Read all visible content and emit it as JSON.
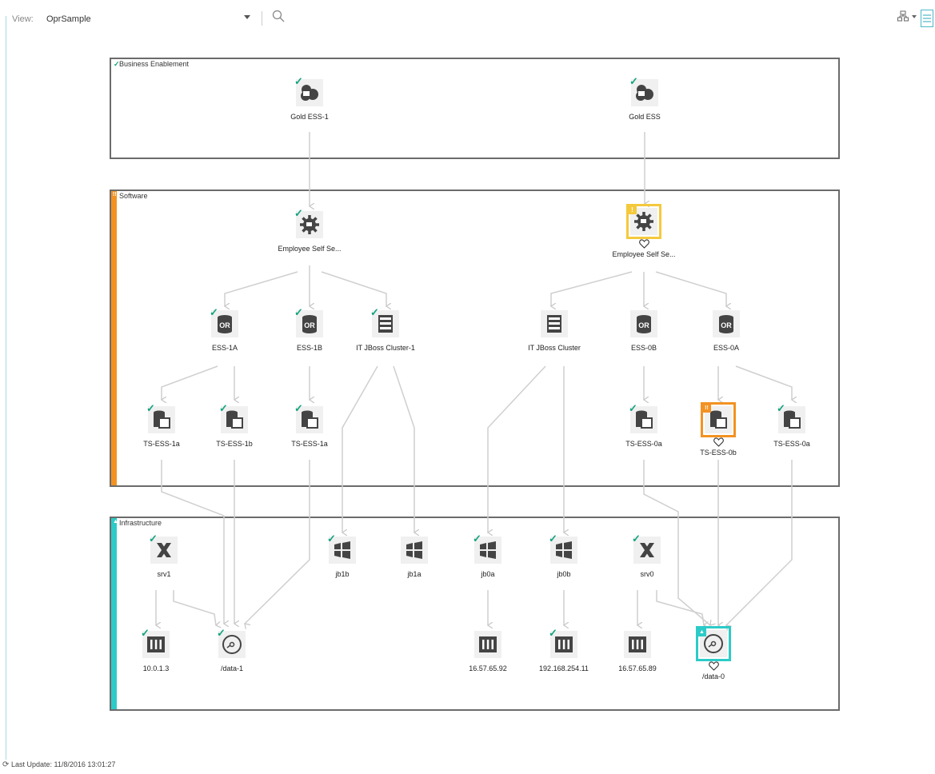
{
  "toolbar": {
    "view_label": "View:",
    "view_value": "OprSample"
  },
  "groups": [
    {
      "id": "business",
      "title": "Business Enablement",
      "status": "ok",
      "status_color": "#14a37f"
    },
    {
      "id": "software",
      "title": "Software",
      "status": "major",
      "status_color": "#f39222"
    },
    {
      "id": "infra",
      "title": "Infrastructure",
      "status": "warning",
      "status_color": "#2ccbc7"
    }
  ],
  "nodes": [
    {
      "id": "gold1",
      "label": "Gold ESS-1",
      "icon": "cloud-icon",
      "status": "ok"
    },
    {
      "id": "gold0",
      "label": "Gold ESS",
      "icon": "cloud-icon",
      "status": "ok"
    },
    {
      "id": "emp1",
      "label": "Employee Self Se...",
      "icon": "gear-icon",
      "status": "ok"
    },
    {
      "id": "emp0",
      "label": "Employee Self Se...",
      "icon": "gear-icon",
      "status": "minor",
      "frame_color": "#f5c93c",
      "heart": true
    },
    {
      "id": "ess1a",
      "label": "ESS-1A",
      "icon": "oracle-db-icon",
      "status": "ok"
    },
    {
      "id": "ess1b",
      "label": "ESS-1B",
      "icon": "oracle-db-icon",
      "status": "ok"
    },
    {
      "id": "jbc1",
      "label": "IT JBoss Cluster-1",
      "icon": "server-icon",
      "status": "ok"
    },
    {
      "id": "jbc0",
      "label": "IT JBoss Cluster",
      "icon": "server-icon",
      "status": "none"
    },
    {
      "id": "ess0b",
      "label": "ESS-0B",
      "icon": "oracle-db-icon",
      "status": "none"
    },
    {
      "id": "ess0a",
      "label": "ESS-0A",
      "icon": "oracle-db-icon",
      "status": "none"
    },
    {
      "id": "ts1a_1",
      "label": "TS-ESS-1a",
      "icon": "tablespace-icon",
      "status": "ok"
    },
    {
      "id": "ts1b",
      "label": "TS-ESS-1b",
      "icon": "tablespace-icon",
      "status": "ok"
    },
    {
      "id": "ts1a_2",
      "label": "TS-ESS-1a",
      "icon": "tablespace-icon",
      "status": "ok"
    },
    {
      "id": "ts0a_1",
      "label": "TS-ESS-0a",
      "icon": "tablespace-icon",
      "status": "ok"
    },
    {
      "id": "ts0b",
      "label": "TS-ESS-0b",
      "icon": "tablespace-icon",
      "status": "major",
      "frame_color": "#f39222",
      "heart": true
    },
    {
      "id": "ts0a_2",
      "label": "TS-ESS-0a",
      "icon": "tablespace-icon",
      "status": "ok"
    },
    {
      "id": "srv1",
      "label": "srv1",
      "icon": "x-server-icon",
      "status": "ok"
    },
    {
      "id": "jb1b",
      "label": "jb1b",
      "icon": "windows-icon",
      "status": "ok"
    },
    {
      "id": "jb1a",
      "label": "jb1a",
      "icon": "windows-icon",
      "status": "none"
    },
    {
      "id": "jb0a",
      "label": "jb0a",
      "icon": "windows-icon",
      "status": "ok"
    },
    {
      "id": "jb0b",
      "label": "jb0b",
      "icon": "windows-icon",
      "status": "ok"
    },
    {
      "id": "srv0",
      "label": "srv0",
      "icon": "x-server-icon",
      "status": "ok"
    },
    {
      "id": "ip1",
      "label": "10.0.1.3",
      "icon": "network-interface-icon",
      "status": "ok"
    },
    {
      "id": "data1",
      "label": "/data-1",
      "icon": "disk-icon",
      "status": "ok"
    },
    {
      "id": "ip2",
      "label": "16.57.65.92",
      "icon": "network-interface-icon",
      "status": "none"
    },
    {
      "id": "ip3",
      "label": "192.168.254.11",
      "icon": "network-interface-icon",
      "status": "ok"
    },
    {
      "id": "ip4",
      "label": "16.57.65.89",
      "icon": "network-interface-icon",
      "status": "none"
    },
    {
      "id": "data0",
      "label": "/data-0",
      "icon": "disk-icon",
      "status": "warning",
      "frame_color": "#2ccbc7",
      "heart": true
    }
  ],
  "footer": {
    "last_update": "Last Update: 11/8/2016 13:01:27"
  }
}
